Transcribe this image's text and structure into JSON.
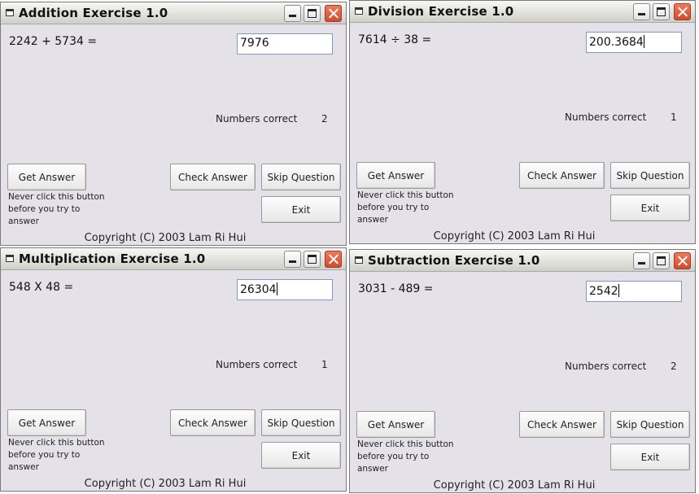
{
  "windows": [
    {
      "title": "Addition Exercise 1.0",
      "question": "2242 + 5734 =",
      "answer_value": "7976",
      "correct_label": "Numbers correct",
      "correct_count": "2",
      "buttons": {
        "get_answer": "Get Answer",
        "check_answer": "Check Answer",
        "skip_question": "Skip Question",
        "exit": "Exit"
      },
      "warning": "Never click this button before you try to answer",
      "copyright": "Copyright (C) 2003 Lam Ri Hui"
    },
    {
      "title": "Division Exercise 1.0",
      "question": "7614 ÷ 38 =",
      "answer_value": "200.3684",
      "correct_label": "Numbers correct",
      "correct_count": "1",
      "buttons": {
        "get_answer": "Get Answer",
        "check_answer": "Check Answer",
        "skip_question": "Skip Question",
        "exit": "Exit"
      },
      "warning": "Never click this button before you try to answer",
      "copyright": "Copyright (C) 2003 Lam Ri Hui"
    },
    {
      "title": "Multiplication Exercise 1.0",
      "question": "548 X 48 =",
      "answer_value": "26304",
      "correct_label": "Numbers correct",
      "correct_count": "1",
      "buttons": {
        "get_answer": "Get Answer",
        "check_answer": "Check Answer",
        "skip_question": "Skip Question",
        "exit": "Exit"
      },
      "warning": "Never click this button before you try to answer",
      "copyright": "Copyright (C) 2003 Lam Ri Hui"
    },
    {
      "title": "Subtraction Exercise 1.0",
      "question": "3031 - 489 =",
      "answer_value": "2542",
      "correct_label": "Numbers correct",
      "correct_count": "2",
      "buttons": {
        "get_answer": "Get Answer",
        "check_answer": "Check Answer",
        "skip_question": "Skip Question",
        "exit": "Exit"
      },
      "warning": "Never click this button before you try to answer",
      "copyright": "Copyright (C) 2003 Lam Ri Hui"
    }
  ],
  "icons": {
    "app": "window-app-icon",
    "minimize": "minimize-icon",
    "maximize": "maximize-icon",
    "close": "close-icon"
  },
  "colors": {
    "window_body": "#e5e1e8",
    "close_button": "#d24a2e"
  }
}
